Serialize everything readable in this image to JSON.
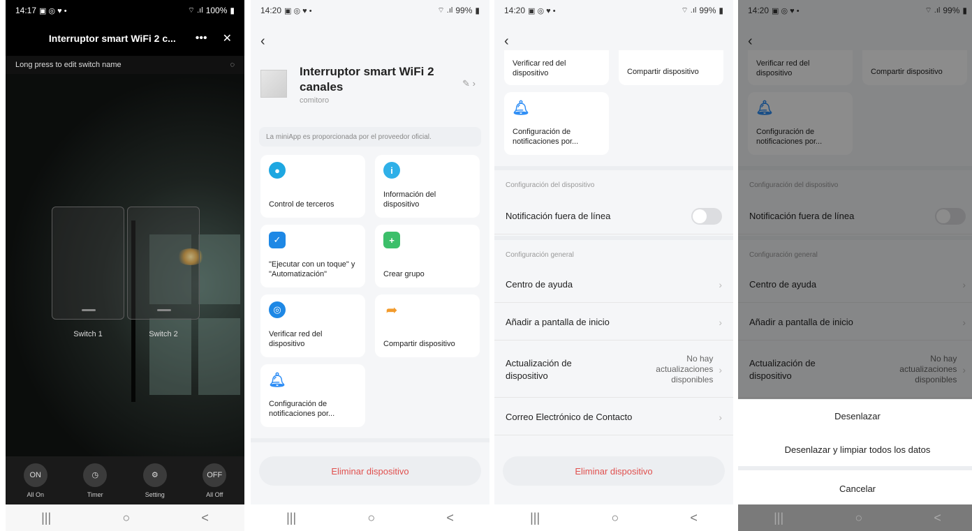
{
  "status": {
    "p1": {
      "time": "14:17",
      "battery": "100%"
    },
    "p2": {
      "time": "14:20",
      "battery": "99%"
    },
    "p3": {
      "time": "14:20",
      "battery": "99%"
    },
    "p4": {
      "time": "14:20",
      "battery": "99%"
    }
  },
  "panel1": {
    "title": "Interruptor smart WiFi 2 c...",
    "more_icon": "more-icon",
    "close_icon": "close-icon",
    "hint": "Long press to edit switch name",
    "switches": [
      {
        "label": "Switch 1"
      },
      {
        "label": "Switch 2"
      }
    ],
    "buttons": [
      {
        "glyph": "ON",
        "label": "All On"
      },
      {
        "glyph": "◷",
        "label": "Timer"
      },
      {
        "glyph": "⚙",
        "label": "Setting"
      },
      {
        "glyph": "OFF",
        "label": "All Off"
      }
    ]
  },
  "device": {
    "name": "Interruptor smart WiFi 2 canales",
    "room": "comitoro",
    "notice": "La miniApp es proporcionada por el proveedor oficial."
  },
  "cards": [
    {
      "label": "Control de terceros",
      "icon": "alexa-google-icon",
      "color": "#1ea7e1"
    },
    {
      "label": "Información del dispositivo",
      "icon": "info-icon",
      "color": "#2fb0e8"
    },
    {
      "label": "\"Ejecutar con un toque\" y \"Automatización\"",
      "icon": "check-icon",
      "color": "#1e88e5"
    },
    {
      "label": "Crear grupo",
      "icon": "group-add-icon",
      "color": "#3cbf6a"
    },
    {
      "label": "Verificar red del dispositivo",
      "icon": "network-check-icon",
      "color": "#1e88e5"
    },
    {
      "label": "Compartir dispositivo",
      "icon": "share-icon",
      "color": "#f29b2c"
    },
    {
      "label": "Configuración de notificaciones por...",
      "icon": "bell-icon",
      "color": "#2f8ef5"
    }
  ],
  "delete_label": "Eliminar dispositivo",
  "settings": {
    "device_section": "Configuración del dispositivo",
    "offline_notification": "Notificación fuera de línea",
    "general_section": "Configuración general",
    "help_center": "Centro de ayuda",
    "add_home": "Añadir a pantalla de inicio",
    "update_label": "Actualización de dispositivo",
    "update_value": "No hay actualizaciones disponibles",
    "contact_email": "Correo Electrónico de Contacto"
  },
  "sheet": {
    "unlink": "Desenlazar",
    "unlink_clear": "Desenlazar y limpiar todos los datos",
    "cancel": "Cancelar"
  },
  "navbar": {
    "recents": "|||",
    "home": "○",
    "back": "<"
  }
}
